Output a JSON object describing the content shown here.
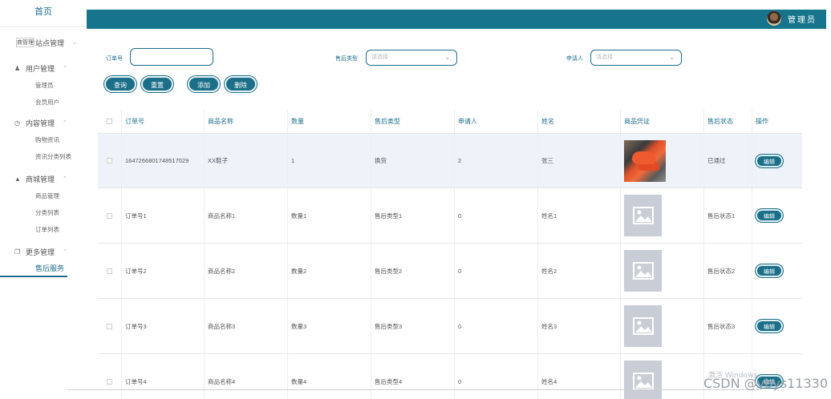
{
  "sidebar": {
    "home": "首页",
    "groups": [
      {
        "title": "站点管理",
        "overlay": "商管理",
        "items": []
      },
      {
        "title": "用户管理",
        "items": [
          "管理员",
          "会员用户"
        ]
      },
      {
        "title": "内容管理",
        "items": [
          "购物资讯",
          "资讯分类列表"
        ]
      },
      {
        "title": "商城管理",
        "items": [
          "商品管理",
          "分类列表",
          "订单列表"
        ]
      },
      {
        "title": "更多管理",
        "items": [
          "售后服务"
        ]
      }
    ]
  },
  "topbar": {
    "admin_label": "管理员"
  },
  "filters": {
    "order_label": "订单号",
    "order_value": "",
    "type_label": "售后类型",
    "type_placeholder": "请选择",
    "applicant_label": "申请人",
    "applicant_placeholder": "请选择"
  },
  "actions": {
    "search": "查询",
    "reset": "重置",
    "add": "添加",
    "delete": "删除"
  },
  "table": {
    "headers": [
      "订单号",
      "商品名称",
      "数量",
      "售后类型",
      "申请人",
      "姓名",
      "商品凭证",
      "售后状态",
      "操作"
    ],
    "edit_label": "编辑",
    "rows": [
      {
        "order": "1647266801748517029",
        "name": "XX鞋子",
        "qty": "1",
        "type": "换货",
        "applicant": "2",
        "person": "张三",
        "image": "photo",
        "status": "已通过"
      },
      {
        "order": "订单号1",
        "name": "商品名称1",
        "qty": "数量1",
        "type": "售后类型1",
        "applicant": "0",
        "person": "姓名1",
        "image": "placeholder",
        "status": "售后状态1"
      },
      {
        "order": "订单号2",
        "name": "商品名称2",
        "qty": "数量2",
        "type": "售后类型2",
        "applicant": "0",
        "person": "姓名2",
        "image": "placeholder",
        "status": "售后状态2"
      },
      {
        "order": "订单号3",
        "name": "商品名称3",
        "qty": "数量3",
        "type": "售后类型3",
        "applicant": "0",
        "person": "姓名3",
        "image": "placeholder",
        "status": "售后状态3"
      },
      {
        "order": "订单号4",
        "name": "商品名称4",
        "qty": "数量4",
        "type": "售后类型4",
        "applicant": "0",
        "person": "姓名4",
        "image": "placeholder",
        "status": ""
      }
    ]
  },
  "watermark": {
    "line1": "激活 Windows",
    "line2": "CSDN @vbys11330"
  },
  "colors": {
    "accent": "#16758c",
    "button": "#1b6f88",
    "row_highlight": "#eef3f9",
    "placeholder_image": "#c9ced6"
  }
}
